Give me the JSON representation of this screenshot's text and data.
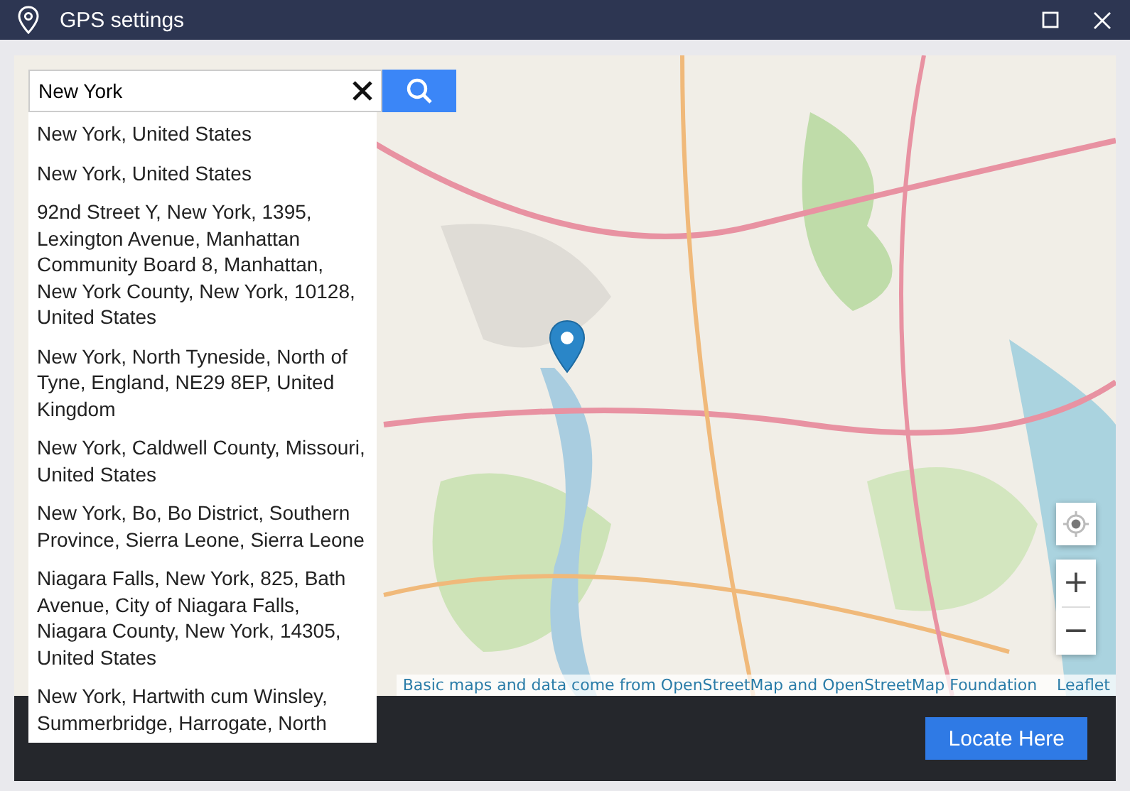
{
  "window": {
    "title": "GPS settings"
  },
  "search": {
    "value": "New York"
  },
  "results": [
    {
      "text": "New York, United States"
    },
    {
      "text": "New York, United States"
    },
    {
      "text": "92nd Street Y, New York, 1395, Lexington Avenue, Manhattan Community Board 8, Manhattan, New York County, New York, 10128, United States"
    },
    {
      "text": "New York, North Tyneside, North of Tyne, England, NE29 8EP, United Kingdom"
    },
    {
      "text": "New York, Caldwell County, Missouri, United States"
    },
    {
      "text": "New York, Bo, Bo District, Southern Province, Sierra Leone, Sierra Leone"
    },
    {
      "text": "Niagara Falls, New York, 825, Bath Avenue, City of Niagara Falls, Niagara County, New York, 14305, United States"
    },
    {
      "text": "New York, Hartwith cum Winsley, Summerbridge, Harrogate, North"
    }
  ],
  "map": {
    "kind": "picture",
    "zoom_in": "+",
    "zoom_out": "−",
    "attribution": "Basic maps and data come from OpenStreetMap and OpenStreetMap Foundation",
    "attribution_link": "Leaflet"
  },
  "footer": {
    "button": "Locate Here"
  }
}
